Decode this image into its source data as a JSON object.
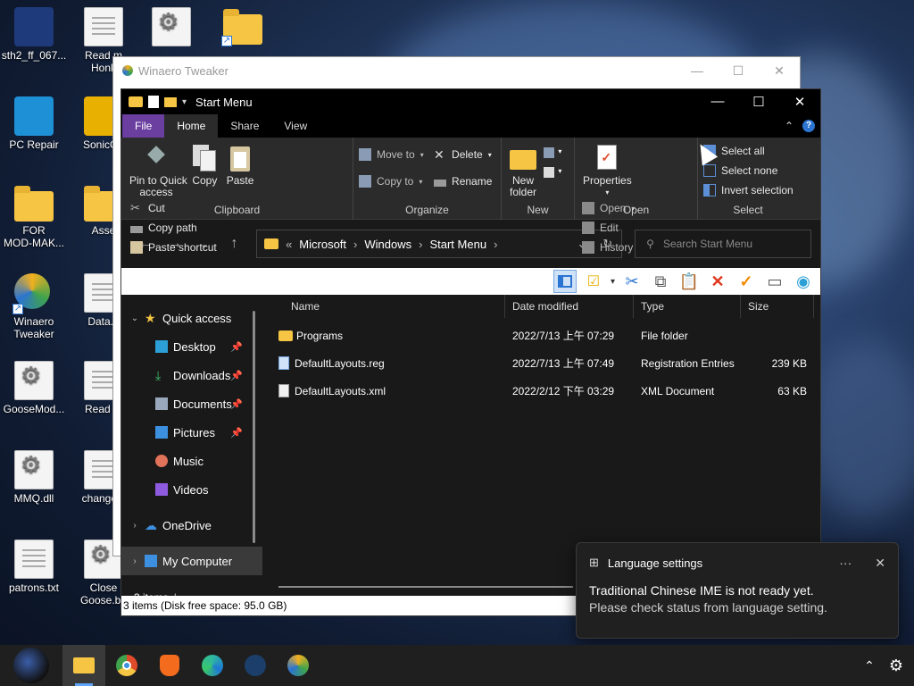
{
  "desktop": {
    "icons": [
      {
        "label": "sth2_ff_067...",
        "kind": "image"
      },
      {
        "label": "Read m\nHonk",
        "kind": "doc"
      },
      {
        "label": "",
        "kind": "gear"
      },
      {
        "label": "",
        "kind": "folder"
      },
      {
        "label": "PC Repair",
        "kind": "app"
      },
      {
        "label": "SonicGa",
        "kind": "app"
      },
      {
        "label": "FOR\nMOD-MAK...",
        "kind": "folder"
      },
      {
        "label": "Asse",
        "kind": "folder"
      },
      {
        "label": "Winaero\nTweaker",
        "kind": "app"
      },
      {
        "label": "Data.b",
        "kind": "doc"
      },
      {
        "label": "GooseMod...",
        "kind": "gear"
      },
      {
        "label": "Read M",
        "kind": "doc"
      },
      {
        "label": "MMQ.dll",
        "kind": "gear"
      },
      {
        "label": "changelo",
        "kind": "doc"
      },
      {
        "label": "patrons.txt",
        "kind": "doc"
      },
      {
        "label": "Close\nGoose.ba",
        "kind": "gear"
      }
    ]
  },
  "winaero": {
    "title": "Winaero Tweaker"
  },
  "explorer": {
    "title": "Start Menu",
    "tabs": [
      "File",
      "Home",
      "Share",
      "View"
    ],
    "active_tab": "Home",
    "ribbon": {
      "clipboard": {
        "pin": "Pin to Quick\naccess",
        "copy": "Copy",
        "paste": "Paste",
        "cut": "Cut",
        "copy_path": "Copy path",
        "paste_shortcut": "Paste shortcut",
        "label": "Clipboard"
      },
      "organize": {
        "move_to": "Move to",
        "copy_to": "Copy to",
        "delete": "Delete",
        "rename": "Rename",
        "label": "Organize"
      },
      "new": {
        "new_folder": "New\nfolder",
        "label": "New"
      },
      "open": {
        "properties": "Properties",
        "open": "Open",
        "edit": "Edit",
        "history": "History",
        "label": "Open"
      },
      "select": {
        "select_all": "Select all",
        "select_none": "Select none",
        "invert": "Invert selection",
        "label": "Select"
      }
    },
    "address": {
      "path": [
        "Microsoft",
        "Windows",
        "Start Menu"
      ]
    },
    "search": {
      "placeholder": "Search Start Menu"
    },
    "nav": [
      {
        "label": "Quick access",
        "pinned": false
      },
      {
        "label": "Desktop",
        "pinned": true
      },
      {
        "label": "Downloads",
        "pinned": true
      },
      {
        "label": "Documents",
        "pinned": true
      },
      {
        "label": "Pictures",
        "pinned": true
      },
      {
        "label": "Music",
        "pinned": false
      },
      {
        "label": "Videos",
        "pinned": false
      },
      {
        "label": "OneDrive",
        "pinned": false
      },
      {
        "label": "My Computer",
        "pinned": false
      }
    ],
    "columns": [
      "Name",
      "Date modified",
      "Type",
      "Size"
    ],
    "files": [
      {
        "name": "Programs",
        "date": "2022/7/13 上午 07:29",
        "type": "File folder",
        "size": ""
      },
      {
        "name": "DefaultLayouts.reg",
        "date": "2022/7/13 上午 07:49",
        "type": "Registration Entries",
        "size": "239 KB"
      },
      {
        "name": "DefaultLayouts.xml",
        "date": "2022/2/12 下午 03:29",
        "type": "XML Document",
        "size": "63 KB"
      }
    ],
    "status_items": "3 items",
    "status_disk": "3 items (Disk free space: 95.0 GB)"
  },
  "toast": {
    "title": "Language settings",
    "line1": "Traditional Chinese IME is not ready yet.",
    "line2": "Please check status from language setting."
  },
  "colors": {
    "file_tab": "#6b3fa0",
    "accent": "#2b74d1",
    "folder": "#f5c543"
  }
}
